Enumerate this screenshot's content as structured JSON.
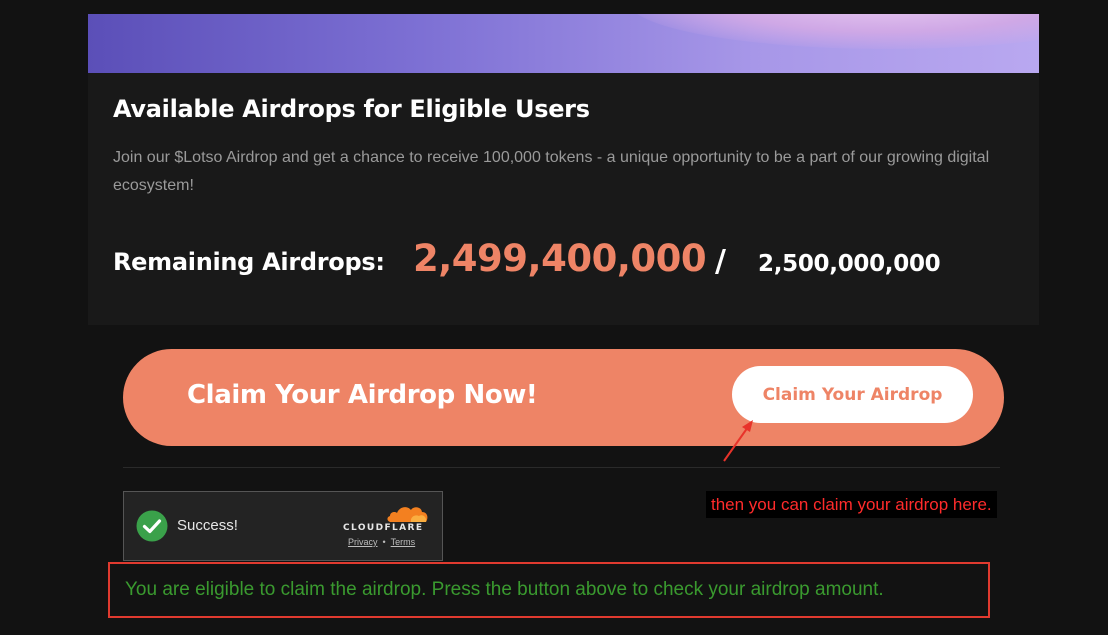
{
  "airdrop_card": {
    "title": "Available Airdrops for Eligible Users",
    "description": "Join our $Lotso Airdrop and get a chance to receive 100,000 tokens - a unique opportunity to be a part of our growing digital ecosystem!",
    "remaining_label": "Remaining Airdrops:",
    "remaining_value": "2,499,400,000",
    "separator": "/",
    "total_value": "2,500,000,000"
  },
  "claim_banner": {
    "title": "Claim Your Airdrop Now!",
    "button_label": "Claim Your Airdrop"
  },
  "annotation": {
    "note": "then you can claim your airdrop here."
  },
  "captcha": {
    "status": "Success!",
    "brand": "CLOUDFLARE",
    "privacy_label": "Privacy",
    "separator": "•",
    "terms_label": "Terms",
    "check_icon": "check-circle-icon",
    "cloud_icon": "cloudflare-logo"
  },
  "eligibility": {
    "message": "You are eligible to claim the airdrop. Press the button above to check your airdrop amount."
  },
  "colors": {
    "accent": "#ee8466",
    "success": "#3a9a2f",
    "annotation": "#ff2b2b",
    "background": "#121212",
    "card": "#191919"
  }
}
